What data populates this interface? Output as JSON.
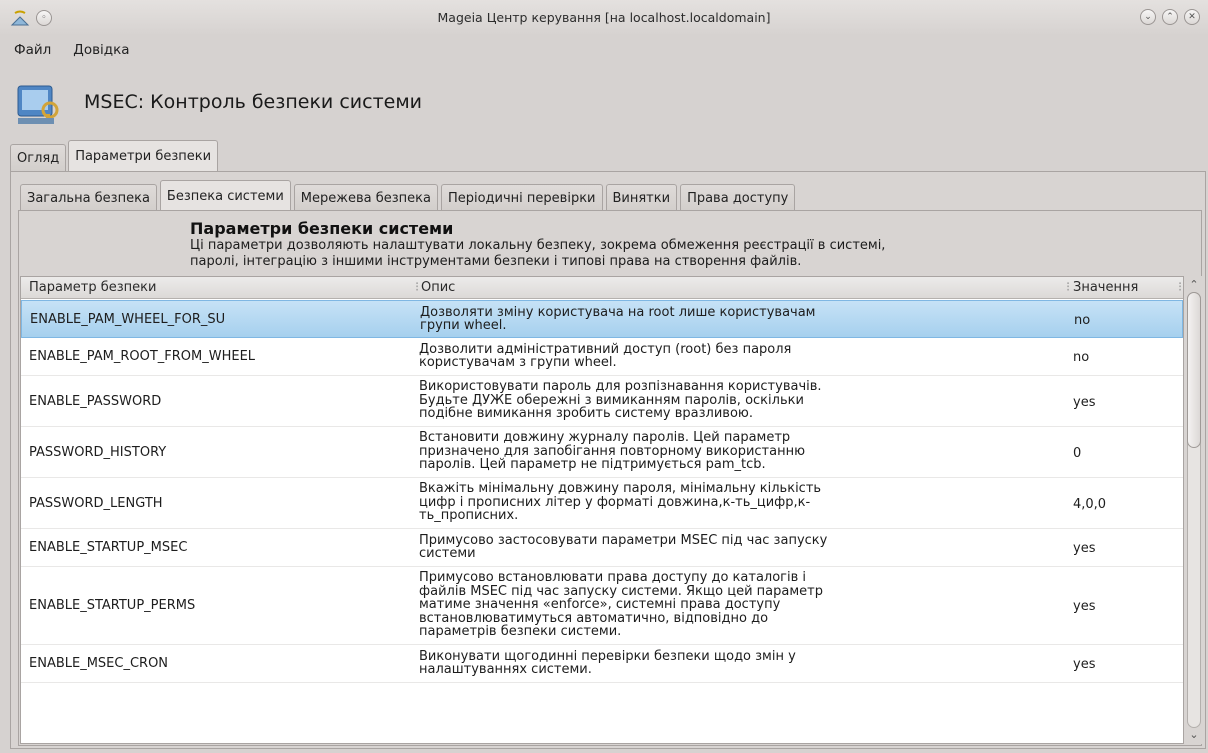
{
  "window": {
    "title": "Mageia Центр керування  [на localhost.localdomain]"
  },
  "menubar": {
    "items": [
      "Файл",
      "Довідка"
    ]
  },
  "header": {
    "title": "MSEC: Контроль безпеки системи"
  },
  "outer_tabs": [
    {
      "label": "Огляд",
      "active": false
    },
    {
      "label": "Параметри безпеки",
      "active": true
    }
  ],
  "inner_tabs": [
    {
      "label": "Загальна безпека",
      "active": false
    },
    {
      "label": "Безпека системи",
      "active": true
    },
    {
      "label": "Мережева безпека",
      "active": false
    },
    {
      "label": "Періодичні перевірки",
      "active": false
    },
    {
      "label": "Винятки",
      "active": false
    },
    {
      "label": "Права доступу",
      "active": false
    }
  ],
  "section": {
    "title": "Параметри безпеки системи",
    "description_line1": "Ці параметри дозволяють налаштувати локальну безпеку, зокрема обмеження реєстрації в системі,",
    "description_line2": "паролі, інтеграцію з іншими інструментами безпеки і типові права на створення файлів."
  },
  "table": {
    "columns": [
      "Параметр безпеки",
      "Опис",
      "Значення"
    ],
    "rows": [
      {
        "name": "ENABLE_PAM_WHEEL_FOR_SU",
        "desc": [
          "Дозволяти зміну користувача на root лише користувачам",
          "групи wheel."
        ],
        "value": "no",
        "selected": true
      },
      {
        "name": "ENABLE_PAM_ROOT_FROM_WHEEL",
        "desc": [
          "Дозволити адміністративний доступ (root) без пароля",
          "користувачам з групи wheel."
        ],
        "value": "no",
        "selected": false
      },
      {
        "name": "ENABLE_PASSWORD",
        "desc": [
          "Використовувати пароль для розпізнавання користувачів.",
          "Будьте ДУЖЕ обережні з вимиканням паролів, оскільки",
          "подібне вимикання зробить систему вразливою."
        ],
        "value": "yes",
        "selected": false
      },
      {
        "name": "PASSWORD_HISTORY",
        "desc": [
          "Встановити довжину журналу паролів. Цей параметр",
          "призначено для запобігання повторному використанню",
          "паролів. Цей параметр не підтримується pam_tcb."
        ],
        "value": "0",
        "selected": false
      },
      {
        "name": "PASSWORD_LENGTH",
        "desc": [
          "Вкажіть мінімальну довжину пароля, мінімальну кількість",
          "цифр і прописних літер у форматі довжина,к-ть_цифр,к-",
          "ть_прописних."
        ],
        "value": "4,0,0",
        "selected": false
      },
      {
        "name": "ENABLE_STARTUP_MSEC",
        "desc": [
          "Примусово застосовувати параметри MSEC під час запуску",
          "системи"
        ],
        "value": "yes",
        "selected": false
      },
      {
        "name": "ENABLE_STARTUP_PERMS",
        "desc": [
          "Примусово встановлювати права доступу до каталогів і",
          "файлів MSEC під час запуску системи. Якщо цей параметр",
          "матиме значення «enforce», системні права доступу",
          "встановлюватимуться автоматично, відповідно до",
          "параметрів безпеки системи."
        ],
        "value": "yes",
        "selected": false
      },
      {
        "name": "ENABLE_MSEC_CRON",
        "desc": [
          "Виконувати щогодинні перевірки безпеки щодо змін у",
          "налаштуваннях системи."
        ],
        "value": "yes",
        "selected": false
      }
    ]
  },
  "scrollbar": {
    "position_fraction": 0.0
  }
}
